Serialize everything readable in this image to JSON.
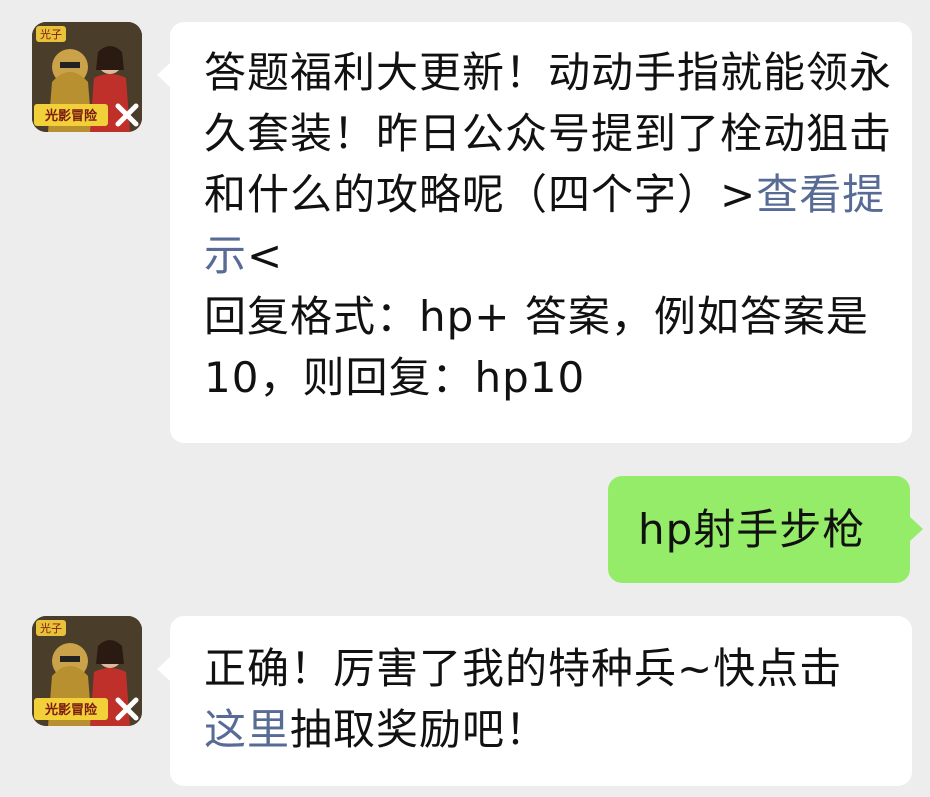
{
  "messages": [
    {
      "sender": "official-account",
      "text_before_link": "答题福利大更新！动动手指就能领永久套装！昨日公众号提到了栓动狙击和什么的攻略呢（四个字）>",
      "link_text": "查看提示",
      "text_after_link": "<",
      "format_line": "回复格式：hp+ 答案，例如答案是10，则回复：hp10"
    },
    {
      "sender": "user",
      "text": "hp射手步枪"
    },
    {
      "sender": "official-account",
      "text_before_link": "正确！厉害了我的特种兵~快点击",
      "link_text": "这里",
      "text_after_link": "抽取奖励吧！"
    }
  ],
  "avatar": {
    "icon": "game-avatar-icon",
    "logo_top": "光子",
    "logo_bottom": "光影冒险"
  },
  "colors": {
    "background": "#ededed",
    "incoming_bubble": "#ffffff",
    "outgoing_bubble": "#95ec69",
    "link": "#576b95"
  }
}
